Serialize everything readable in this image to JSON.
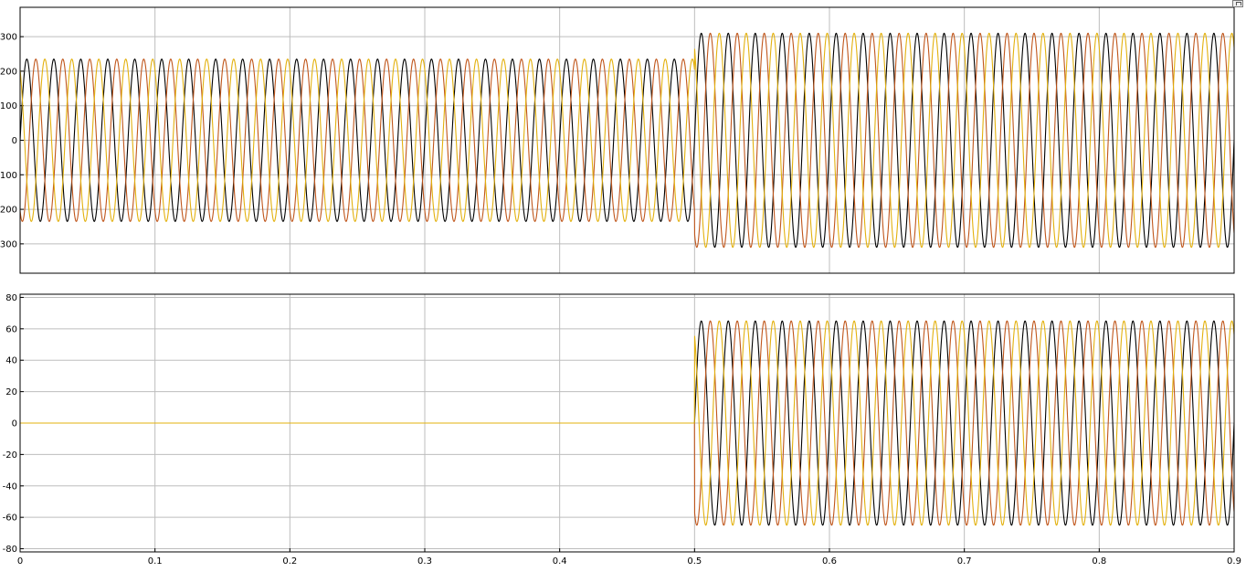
{
  "window": {
    "restore_button": "restore-icon"
  },
  "colors": {
    "phase_a": "#000000",
    "phase_b": "#c0561b",
    "phase_c": "#e3b10e",
    "grid": "#bdbdbd"
  },
  "chart_data": [
    {
      "type": "line",
      "title": "",
      "xlabel": "",
      "ylabel": "",
      "xlim": [
        0,
        0.9
      ],
      "ylim": [
        -385,
        385
      ],
      "yticks": [
        -300,
        -200,
        -100,
        0,
        100,
        200,
        300
      ],
      "grid": true,
      "frequency_hz": 50,
      "series": [
        {
          "color": "#000000",
          "phase_deg": 0,
          "amplitude": [
            {
              "t0": 0,
              "t1": 0.5,
              "amp": 235
            },
            {
              "t0": 0.5,
              "t1": 0.9,
              "amp": 310
            }
          ]
        },
        {
          "color": "#c0561b",
          "phase_deg": -120,
          "amplitude": [
            {
              "t0": 0,
              "t1": 0.5,
              "amp": 235
            },
            {
              "t0": 0.5,
              "t1": 0.9,
              "amp": 310
            }
          ]
        },
        {
          "color": "#e3b10e",
          "phase_deg": 120,
          "amplitude": [
            {
              "t0": 0,
              "t1": 0.5,
              "amp": 235
            },
            {
              "t0": 0.5,
              "t1": 0.9,
              "amp": 310
            }
          ]
        }
      ]
    },
    {
      "type": "line",
      "title": "",
      "xlabel": "",
      "ylabel": "",
      "xlim": [
        0,
        0.9
      ],
      "ylim": [
        -82,
        82
      ],
      "yticks": [
        -80,
        -60,
        -40,
        -20,
        0,
        20,
        40,
        60,
        80
      ],
      "xticks": [
        0,
        0.1,
        0.2,
        0.3,
        0.4,
        0.5,
        0.6,
        0.7,
        0.8,
        0.9
      ],
      "grid": true,
      "frequency_hz": 50,
      "series": [
        {
          "color": "#000000",
          "phase_deg": 0,
          "amplitude": [
            {
              "t0": 0,
              "t1": 0.5,
              "amp": 0
            },
            {
              "t0": 0.5,
              "t1": 0.9,
              "amp": 65
            }
          ]
        },
        {
          "color": "#c0561b",
          "phase_deg": -120,
          "amplitude": [
            {
              "t0": 0,
              "t1": 0.5,
              "amp": 0
            },
            {
              "t0": 0.5,
              "t1": 0.9,
              "amp": 65
            }
          ]
        },
        {
          "color": "#e3b10e",
          "phase_deg": 120,
          "amplitude": [
            {
              "t0": 0,
              "t1": 0.5,
              "amp": 0
            },
            {
              "t0": 0.5,
              "t1": 0.9,
              "amp": 65
            }
          ]
        }
      ]
    }
  ]
}
